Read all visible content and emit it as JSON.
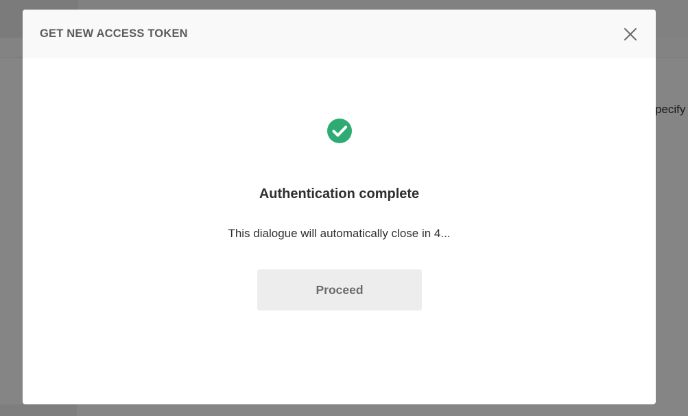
{
  "background": {
    "partial_text": "pecify"
  },
  "modal": {
    "title": "GET NEW ACCESS TOKEN",
    "close_icon": "close-icon",
    "status_icon": "check-circle-icon",
    "heading": "Authentication complete",
    "message": "This dialogue will automatically close in 4...",
    "proceed_label": "Proceed"
  },
  "colors": {
    "success": "#2dab73",
    "overlay": "rgba(0,0,0,0.48)",
    "button_bg": "#ededed"
  }
}
